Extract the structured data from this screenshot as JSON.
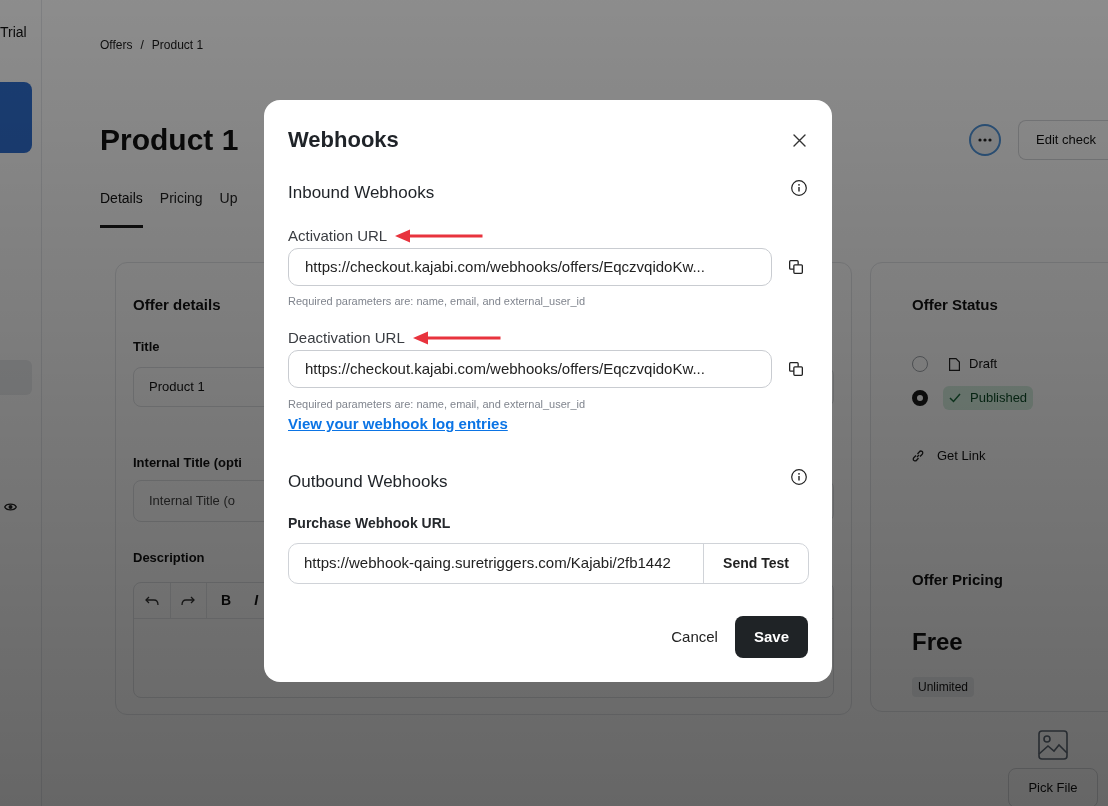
{
  "background": {
    "sidebar": {
      "label": "Trial"
    },
    "breadcrumb": {
      "items": [
        "Offers",
        "Product 1"
      ],
      "separator": "/"
    },
    "title": "Product 1",
    "header_button": "Edit check",
    "tabs": [
      {
        "label": "Details",
        "selected": true
      },
      {
        "label": "Pricing",
        "selected": false
      },
      {
        "label": "Up",
        "selected": false
      }
    ],
    "offer_details": {
      "heading": "Offer details",
      "fields": [
        {
          "label": "Title",
          "value": "Product 1"
        },
        {
          "label": "Internal Title (opti",
          "placeholder": "Internal Title (o"
        }
      ],
      "description_label": "Description",
      "toolbar": [
        {
          "label": "B",
          "kind": "bold"
        },
        {
          "label": "I",
          "kind": "italic"
        }
      ]
    },
    "offer_status": {
      "heading": "Offer Status",
      "options": [
        {
          "label": "Draft",
          "kind": "draft",
          "selected": false
        },
        {
          "label": "Published",
          "kind": "published",
          "selected": true
        }
      ],
      "link": "Get Link"
    },
    "offer_pricing": {
      "heading": "Offer Pricing",
      "price": "Free",
      "badge": "Unlimited"
    },
    "file_button": "Pick File"
  },
  "modal": {
    "title": "Webhooks",
    "sections": [
      {
        "heading": "Inbound Webhooks",
        "fields": [
          {
            "kind": "copy",
            "label": "Activation URL",
            "arrow": true,
            "value": "https://checkout.kajabi.com/webhooks/offers/EqczvqidoKw...",
            "hint": "Required parameters are: name, email, and external_user_id"
          },
          {
            "kind": "copy",
            "label": "Deactivation URL",
            "arrow": true,
            "value": "https://checkout.kajabi.com/webhooks/offers/EqczvqidoKw...",
            "hint": "Required parameters are: name, email, and external_user_id"
          }
        ],
        "link": "View your webhook log entries"
      },
      {
        "heading": "Outbound Webhooks",
        "fields": [
          {
            "kind": "test",
            "label": "Purchase Webhook URL",
            "value": "https://webhook-qaing.suretriggers.com/Kajabi/2fb1442",
            "button": "Send Test"
          }
        ]
      }
    ],
    "buttons": [
      {
        "label": "Cancel",
        "kind": "secondary"
      },
      {
        "label": "Save",
        "kind": "primary"
      }
    ]
  }
}
